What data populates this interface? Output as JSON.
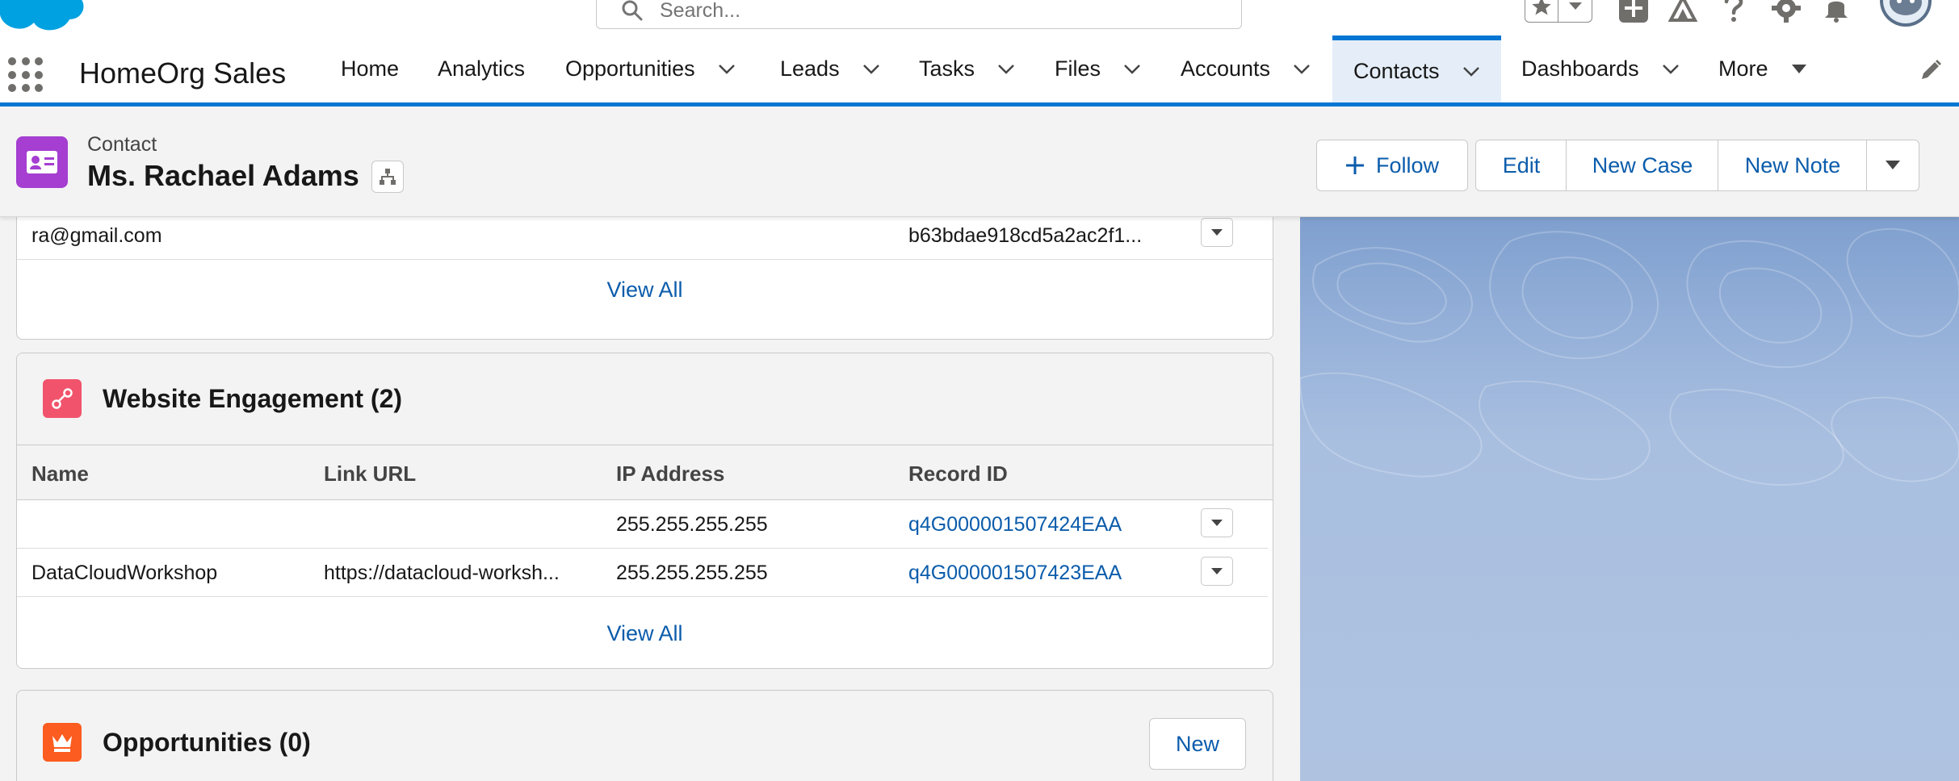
{
  "global_header": {
    "search_placeholder": "Search..."
  },
  "nav": {
    "app_name": "HomeOrg Sales",
    "items": [
      {
        "label": "Home"
      },
      {
        "label": "Analytics"
      },
      {
        "label": "Opportunities"
      },
      {
        "label": "Leads"
      },
      {
        "label": "Tasks"
      },
      {
        "label": "Files"
      },
      {
        "label": "Accounts"
      },
      {
        "label": "Contacts"
      },
      {
        "label": "Dashboards"
      },
      {
        "label": "More"
      }
    ],
    "active_item": "Contacts"
  },
  "record": {
    "object_type": "Contact",
    "name": "Ms. Rachael Adams",
    "actions": {
      "follow": "Follow",
      "edit": "Edit",
      "new_case": "New Case",
      "new_note": "New Note"
    }
  },
  "top_related": {
    "row": {
      "col1": "ra@gmail.com",
      "col2": "b63bdae918cd5a2ac2f1..."
    },
    "view_all": "View All"
  },
  "website_engagement": {
    "title": "Website Engagement (2)",
    "columns": [
      "Name",
      "Link URL",
      "IP Address",
      "Record ID"
    ],
    "rows": [
      {
        "name": "",
        "link_url": "",
        "ip": "255.255.255.255",
        "record_id": "q4G000001507424EAA"
      },
      {
        "name": "DataCloudWorkshop",
        "link_url": "https://datacloud-worksh...",
        "ip": "255.255.255.255",
        "record_id": "q4G000001507423EAA"
      }
    ],
    "view_all": "View All"
  },
  "opportunities": {
    "title": "Opportunities (0)",
    "new_label": "New"
  },
  "colors": {
    "brand_blue": "#0176d3",
    "contact_icon": "#a53ed1",
    "engagement_icon": "#f2536c",
    "opportunity_icon": "#fc5c1f",
    "link": "#0b5cab"
  }
}
